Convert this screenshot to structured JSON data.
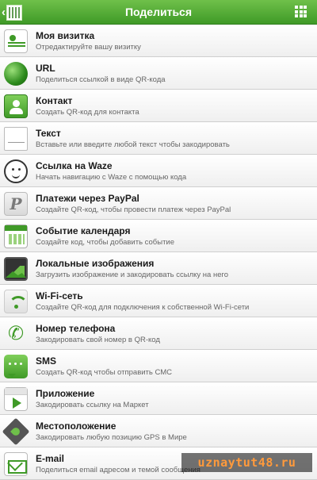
{
  "header": {
    "title": "Поделиться",
    "back_icon": "chevron-left-icon",
    "menu_icon": "grid-menu-icon"
  },
  "colors": {
    "accent": "#4caf2f",
    "bar_top": "#6fc04a",
    "bar_bottom": "#3f9a27"
  },
  "items": [
    {
      "icon": "business-card-icon",
      "title": "Моя визитка",
      "subtitle": "Отредактируйте вашу визитку"
    },
    {
      "icon": "globe-icon",
      "title": "URL",
      "subtitle": "Поделиться ссылкой в виде QR-кода"
    },
    {
      "icon": "contact-icon",
      "title": "Контакт",
      "subtitle": "Создать QR-код для контакта"
    },
    {
      "icon": "text-icon",
      "title": "Текст",
      "subtitle": "Вставьте или введите любой текст чтобы закодировать"
    },
    {
      "icon": "waze-icon",
      "title": "Ссылка на Waze",
      "subtitle": "Начать навигацию с Waze с помощью кода"
    },
    {
      "icon": "paypal-icon",
      "title": "Платежи через PayPal",
      "subtitle": "Создайте QR-код, чтобы провести платеж через PayPal"
    },
    {
      "icon": "calendar-icon",
      "title": "Событие календаря",
      "subtitle": "Создайте код, чтобы добавить событие"
    },
    {
      "icon": "image-icon",
      "title": "Локальные изображения",
      "subtitle": "Загрузить изображение и закодировать ссылку на него"
    },
    {
      "icon": "wifi-icon",
      "title": "Wi-Fi-сеть",
      "subtitle": "Создайте QR-код для подключения к собственной Wi-Fi-сети"
    },
    {
      "icon": "phone-icon",
      "title": "Номер телефона",
      "subtitle": "Закодировать свой номер в QR-код"
    },
    {
      "icon": "sms-icon",
      "title": "SMS",
      "subtitle": "Создать QR-код чтобы отправить СМС"
    },
    {
      "icon": "app-icon",
      "title": "Приложение",
      "subtitle": "Закодировать ссылку на Маркет"
    },
    {
      "icon": "location-icon",
      "title": "Местоположение",
      "subtitle": "Закодировать любую позицию GPS в Мире"
    },
    {
      "icon": "email-icon",
      "title": "E-mail",
      "subtitle": "Поделиться email адресом и темой сообщения"
    }
  ],
  "watermark": "uznaytut48.ru"
}
